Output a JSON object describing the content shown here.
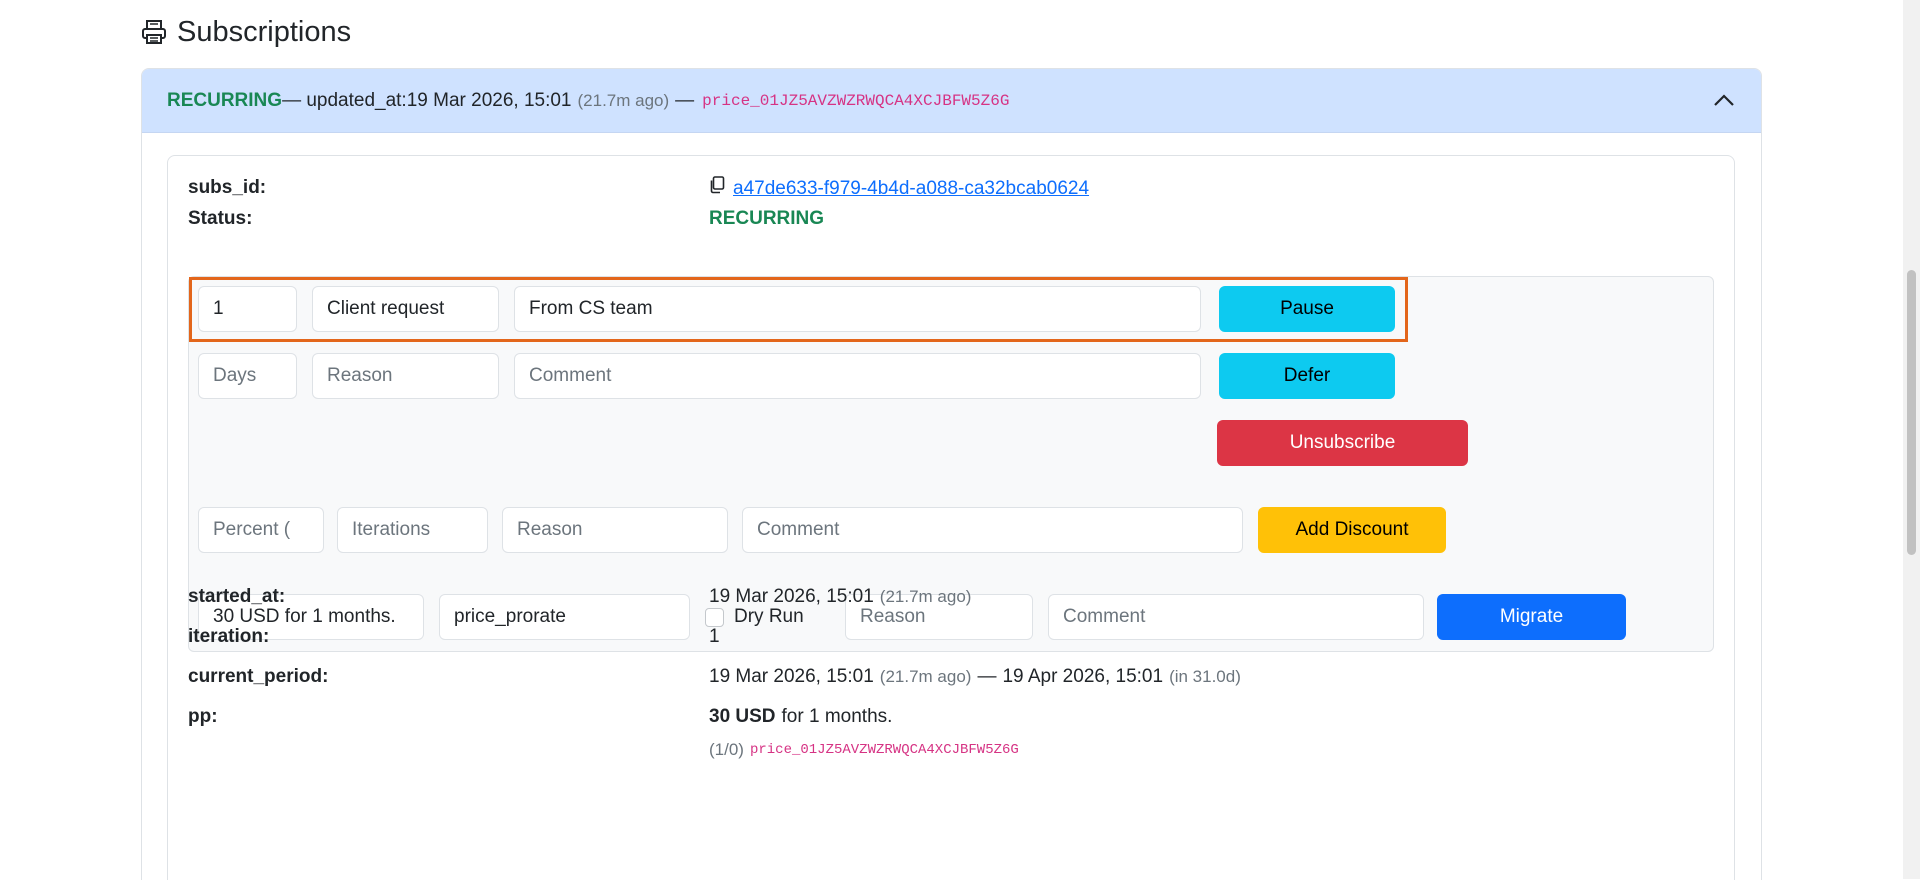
{
  "section": {
    "title": "Subscriptions",
    "icon": "printer-icon"
  },
  "accordion": {
    "status": "RECURRING",
    "updated_text": "— updated_at:19 Mar 2026, 15:01",
    "updated_ago": "(21.7m ago)",
    "separator": "—",
    "price_id": "price_01JZ5AVZWZRWQCA4XCJBFW5Z6G",
    "toggle_icon": "chevron-up-icon"
  },
  "fields": {
    "subs_id_label": "subs_id:",
    "subs_id_value": "a47de633-f979-4b4d-a088-ca32bcab0624",
    "status_label": "Status:",
    "status_value": "RECURRING",
    "started_at_label": "started_at:",
    "started_at_value": "19 Mar 2026, 15:01",
    "started_at_ago": "(21.7m ago)",
    "iteration_label": "iteration:",
    "iteration_value": "1",
    "current_period_label": "current_period:",
    "current_period_start": "19 Mar 2026, 15:01",
    "current_period_start_ago": "(21.7m ago)",
    "current_period_sep": "—",
    "current_period_end": "19 Apr 2026, 15:01",
    "current_period_end_in": "(in 31.0d)",
    "pp_label": "pp:",
    "pp_amount": "30 USD",
    "pp_rest": "for 1 months.",
    "pp_counter": "(1/0)",
    "pp_price_id": "price_01JZ5AVZWZRWQCA4XCJBFW5Z6G"
  },
  "pause_form": {
    "days_value": "1",
    "reason_value": "Client request",
    "comment_value": "From CS team",
    "button": "Pause"
  },
  "defer_form": {
    "days_placeholder": "Days",
    "reason_placeholder": "Reason",
    "comment_placeholder": "Comment",
    "button": "Defer"
  },
  "unsubscribe": {
    "button": "Unsubscribe"
  },
  "discount_form": {
    "percent_placeholder": "Percent (",
    "iterations_placeholder": "Iterations",
    "reason_placeholder": "Reason",
    "comment_placeholder": "Comment",
    "button": "Add Discount"
  },
  "migrate_form": {
    "plan_value": "30 USD for 1 months.",
    "proration_value": "price_prorate",
    "dry_run_label": "Dry Run",
    "dry_run_checked": false,
    "reason_placeholder": "Reason",
    "comment_placeholder": "Comment",
    "button": "Migrate"
  },
  "colors": {
    "header_bg": "#cfe2ff",
    "status_green": "#198754",
    "info": "#0dcaf0",
    "danger": "#dc3545",
    "warning": "#ffc107",
    "primary": "#0d6efd",
    "highlight": "#e3661b",
    "code_pink": "#d63384"
  }
}
